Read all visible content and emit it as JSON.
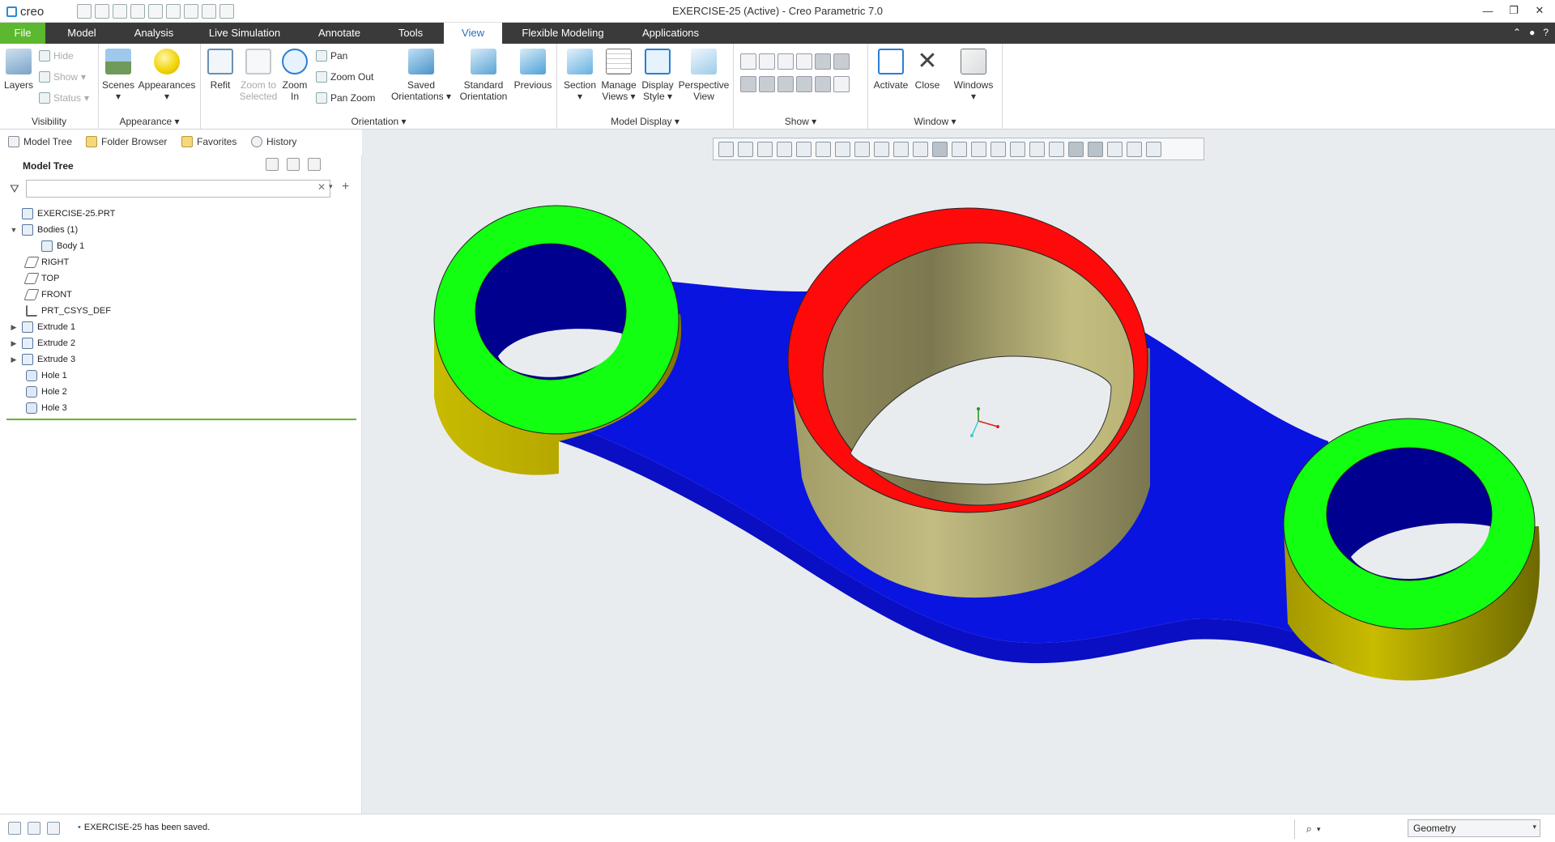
{
  "window": {
    "title": "EXERCISE-25 (Active) - Creo Parametric 7.0",
    "app_logo": "creo",
    "controls": [
      "—",
      "❐",
      "✕"
    ]
  },
  "tabs": [
    "File",
    "Model",
    "Analysis",
    "Live Simulation",
    "Annotate",
    "Tools",
    "View",
    "Flexible Modeling",
    "Applications"
  ],
  "active_tab": "View",
  "tab_right": [
    "⌃",
    "●",
    "?"
  ],
  "ribbon": {
    "visibility": {
      "label": "Visibility",
      "layers": "Layers",
      "hide": "Hide",
      "show": "Show",
      "status": "Status"
    },
    "appearance": {
      "label": "Appearance",
      "scenes": "Scenes",
      "appearances": "Appearances"
    },
    "orientation": {
      "label": "Orientation",
      "refit": "Refit",
      "zoom_to_selected_1": "Zoom to",
      "zoom_to_selected_2": "Selected",
      "zoom_in_1": "Zoom",
      "zoom_in_2": "In",
      "pan": "Pan",
      "zoom_out": "Zoom Out",
      "pan_zoom": "Pan Zoom",
      "saved_1": "Saved",
      "saved_2": "Orientations",
      "standard_1": "Standard",
      "standard_2": "Orientation",
      "previous": "Previous"
    },
    "model_display": {
      "label": "Model Display",
      "section": "Section",
      "manage_1": "Manage",
      "manage_2": "Views",
      "display_1": "Display",
      "display_2": "Style",
      "perspective_1": "Perspective",
      "perspective_2": "View"
    },
    "show": {
      "label": "Show"
    },
    "window": {
      "label": "Window",
      "activate": "Activate",
      "close": "Close",
      "windows": "Windows"
    }
  },
  "navigator": {
    "tabs": [
      "Model Tree",
      "Folder Browser",
      "Favorites",
      "History"
    ],
    "tree_title": "Model Tree",
    "search_placeholder": "",
    "items": [
      {
        "label": "EXERCISE-25.PRT",
        "icon": "part-icon",
        "level": 0,
        "twisty": ""
      },
      {
        "label": "Bodies (1)",
        "icon": "bodies-icon",
        "level": 1,
        "twisty": "▼"
      },
      {
        "label": "Body 1",
        "icon": "body-icon",
        "level": 2,
        "twisty": ""
      },
      {
        "label": "RIGHT",
        "icon": "datum-plane-icon",
        "level": 1,
        "twisty": ""
      },
      {
        "label": "TOP",
        "icon": "datum-plane-icon",
        "level": 1,
        "twisty": ""
      },
      {
        "label": "FRONT",
        "icon": "datum-plane-icon",
        "level": 1,
        "twisty": ""
      },
      {
        "label": "PRT_CSYS_DEF",
        "icon": "csys-icon",
        "level": 1,
        "twisty": ""
      },
      {
        "label": "Extrude 1",
        "icon": "extrude-icon",
        "level": 1,
        "twisty": "▶"
      },
      {
        "label": "Extrude 2",
        "icon": "extrude-icon",
        "level": 1,
        "twisty": "▶"
      },
      {
        "label": "Extrude 3",
        "icon": "extrude-icon",
        "level": 1,
        "twisty": "▶"
      },
      {
        "label": "Hole 1",
        "icon": "hole-icon",
        "level": 1,
        "twisty": ""
      },
      {
        "label": "Hole 2",
        "icon": "hole-icon",
        "level": 1,
        "twisty": ""
      },
      {
        "label": "Hole 3",
        "icon": "hole-icon",
        "level": 1,
        "twisty": ""
      }
    ]
  },
  "status": {
    "message": "EXERCISE-25 has been saved.",
    "filter_value": "Geometry"
  },
  "colors": {
    "file_tab": "#5cb82e",
    "tab_bar": "#3a3a3a",
    "active_tab_text": "#2a6fb8",
    "graphics_bg": "#e9ecef",
    "face_blue": "#0a14e0",
    "face_green": "#12ff12",
    "face_red": "#ff0a0a",
    "face_yellow": "#c4b800",
    "inner_cyl": "#b9b37a"
  }
}
